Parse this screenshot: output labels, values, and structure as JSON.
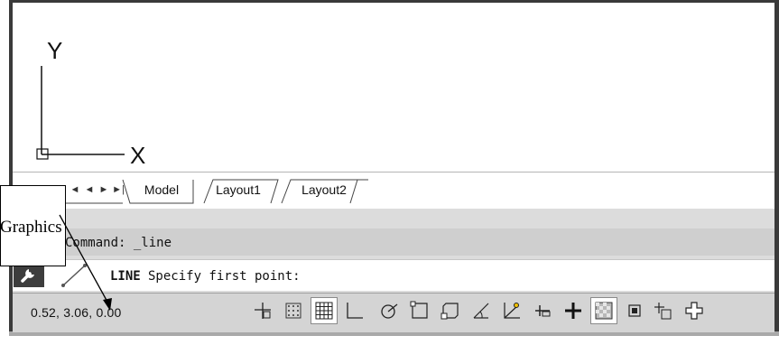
{
  "ucs": {
    "y_label": "Y",
    "x_label": "X"
  },
  "tabs": {
    "nav": [
      "◄",
      "◄",
      "►",
      "►|"
    ],
    "items": [
      {
        "label": "Model",
        "active": true
      },
      {
        "label": "Layout1",
        "active": false
      },
      {
        "label": "Layout2",
        "active": false
      }
    ]
  },
  "command_line": {
    "history": "Command: _line",
    "keyword": "LINE",
    "prompt": "Specify first point:"
  },
  "status_bar": {
    "coordinates": "0.52, 3.06, 0.00",
    "buttons": [
      "infer-constraints-icon",
      "snap-mode-icon",
      "grid-display-icon",
      "ortho-mode-icon",
      "polar-tracking-icon",
      "object-snap-icon",
      "3d-object-snap-icon",
      "object-snap-tracking-icon",
      "dynamic-ucs-icon",
      "dynamic-input-icon",
      "show-lineweight-icon",
      "transparency-icon",
      "quick-properties-icon",
      "selection-cycling-icon",
      "annotation-monitor-icon"
    ]
  },
  "callout": {
    "text": "Graphics"
  },
  "colors": {
    "frame": "#3a3a3a",
    "command_bg": "#cfcfcf",
    "status_bg": "#d4d4d4"
  }
}
